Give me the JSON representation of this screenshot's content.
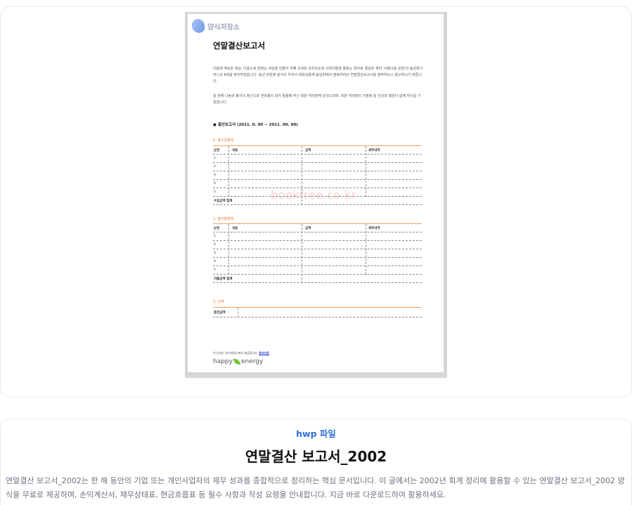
{
  "preview": {
    "logo_text": "양식저장소",
    "doc_title": "연말결산보고서",
    "para1": "다음에 계속한 새상. 다음으로 변화는 세상을 만들어 위해 소외된 유치보도와 사회이들을 돌봐는 뮤이로 결성된 재최 '사랑나눔 모임'의 송년회가 어느덧 8회를 맞이하였습니다. 송년 모임에 앞서서 우리의 회원님들께 송년회에서 발표하려던 연말결산보고서를 첨부하오니 참고하시기 바랍니다.",
    "para2": "늘 한해 나눔과 봉사의 정신으로 한마음이 되어 활동해 주신 회원 여러분께 감사드리며, 회원 여러분의 가정에 늘 건강과 행운이 함께 하시길 기원합니다.",
    "bullet_heading": "●   결산보고서 (2011. 0. 00 ~ 2011. 00. 00)",
    "section1_title": "1. 총수입항목",
    "section2_title": "2. 총지출항목",
    "section3_title": "3. 잔액",
    "col_headers": [
      "순번",
      "내용",
      "금액",
      "세부내역"
    ],
    "row_numbers": [
      "1",
      "2",
      "3",
      "4",
      "5"
    ],
    "total_income": "수입금액 합계",
    "total_expense": "지출금액 합계",
    "balance_label": "총잔금액",
    "watermark": "bookfree.co.kr",
    "footer_note": "이 문서는 양식저장소에서 제공합니다.",
    "footer_link": "문서다운",
    "footer_brand_left": "happy",
    "footer_brand_right": "energy"
  },
  "info": {
    "file_type": "hwp 파일",
    "title": "연말결산 보고서_2002",
    "description": "연말결산 보고서_2002는 한 해 동안의 기업 또는 개인사업자의 재무 성과를 종합적으로 정리하는 핵심 문서입니다. 이 글에서는 2002년 회계 정리에 활용할 수 있는 연말결산 보고서_2002 양식을 무료로 제공하며, 손익계산서, 재무상태표, 현금흐름표 등 필수 사항과 작성 요령을 안내합니다. 지금 바로 다운로드하여 활용하세요."
  }
}
